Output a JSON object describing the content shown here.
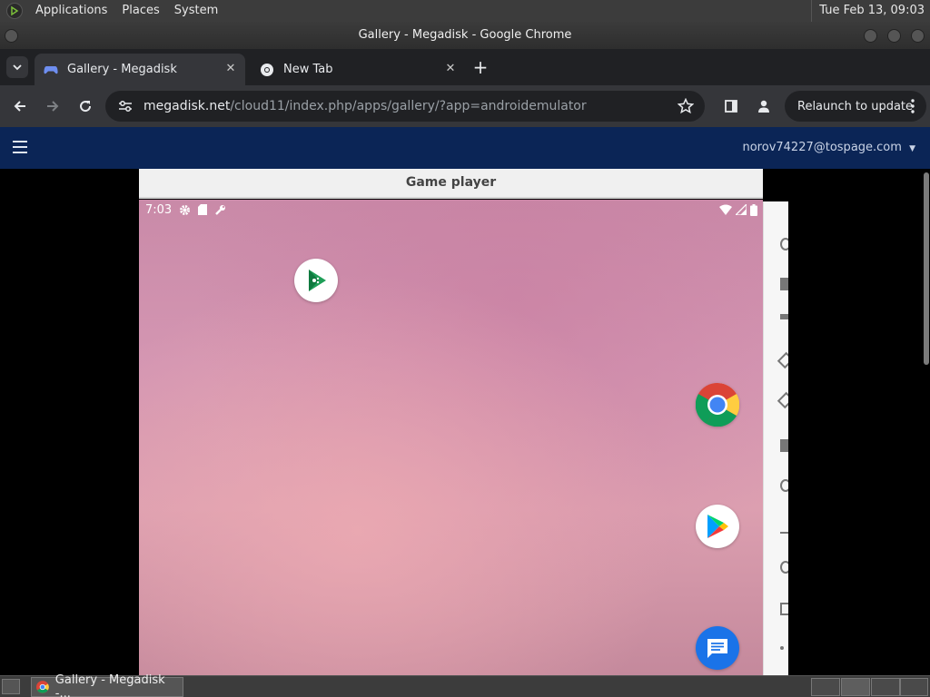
{
  "top_panel": {
    "menus": [
      "Applications",
      "Places",
      "System"
    ],
    "clock": "Tue Feb 13, 09:03"
  },
  "window": {
    "title": "Gallery - Megadisk - Google Chrome"
  },
  "tabs": [
    {
      "title": "Gallery - Megadisk",
      "active": true,
      "icon": "gamepad-icon"
    },
    {
      "title": "New Tab",
      "active": false,
      "icon": "chrome-icon"
    }
  ],
  "address_bar": {
    "host": "megadisk.net",
    "path": "/cloud11/index.php/apps/gallery/?app=androidemulator"
  },
  "relaunch_label": "Relaunch to update",
  "page": {
    "account": "norov74227@tospage.com"
  },
  "game_player": {
    "title": "Game player",
    "status_time": "7:03",
    "home_apps": [
      "play-games-icon",
      "chrome-icon",
      "play-store-icon",
      "messages-icon"
    ]
  },
  "taskbar": {
    "task_label": "Gallery - Megadisk -..."
  },
  "colors": {
    "header_bg": "#0b2556",
    "tab_active": "#35363a",
    "wallpaper": "#d496b2"
  }
}
